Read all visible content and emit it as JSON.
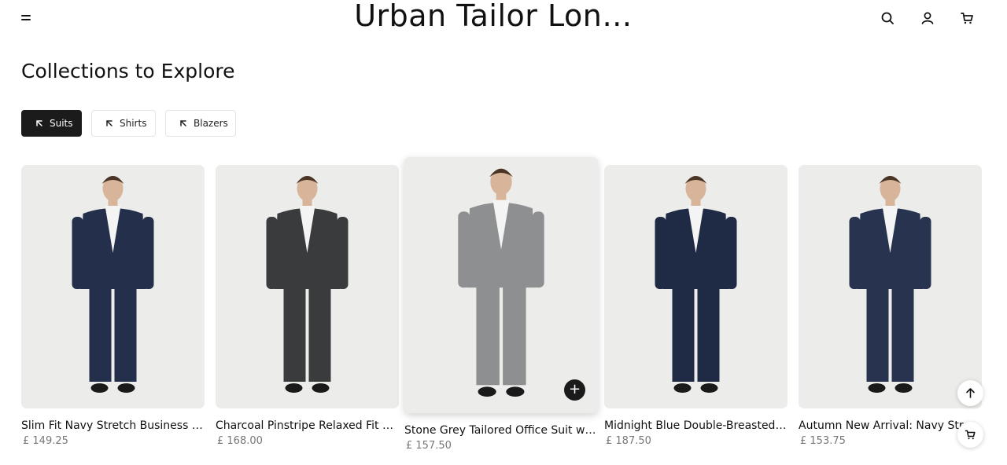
{
  "header": {
    "brand": "Urban Tailor Lon…",
    "icons": [
      "menu-icon",
      "search-icon",
      "account-icon",
      "cart-icon"
    ]
  },
  "section": {
    "title": "Collections to Explore"
  },
  "filters": [
    {
      "label": "Suits",
      "active": true
    },
    {
      "label": "Shirts",
      "active": false
    },
    {
      "label": "Blazers",
      "active": false
    }
  ],
  "products": [
    {
      "name": "Slim Fit Navy Stretch Business Suit f…",
      "price": "£ 149.25",
      "suit_color": "#24304b"
    },
    {
      "name": "Charcoal Pinstripe Relaxed Fit Wool …",
      "price": "£ 168.00",
      "suit_color": "#3a3b3d"
    },
    {
      "name": "Stone Grey Tailored Office Suit with …",
      "price": "£ 157.50",
      "suit_color": "#8e8f91"
    },
    {
      "name": "Midnight Blue Double-Breasted Busi…",
      "price": "£ 187.50",
      "suit_color": "#1f2a45"
    },
    {
      "name": "Autumn New Arrival: Navy Stretch",
      "price": "£ 153.75",
      "suit_color": "#28344f"
    }
  ],
  "colors": {
    "accent": "#1b1b1b",
    "image_bg": "#ececea",
    "price": "#777777"
  },
  "floating": {
    "icons": [
      "arrow-up-icon",
      "cart-icon"
    ]
  }
}
